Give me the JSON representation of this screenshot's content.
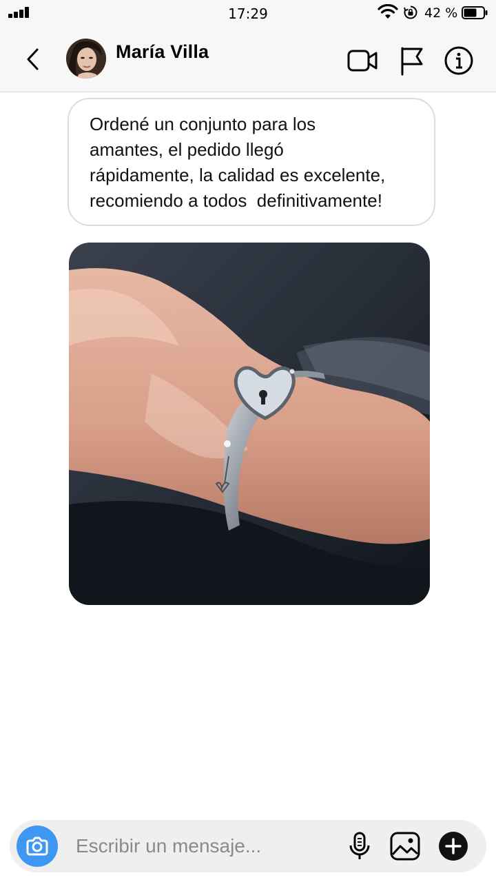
{
  "status_bar": {
    "time": "17:29",
    "battery_percent": "42 %",
    "battery_level": 0.42,
    "signal_bars": 4
  },
  "header": {
    "contact_name": "María Villa",
    "icons": [
      "back-chevron-icon",
      "avatar",
      "video-camera-icon",
      "flag-icon",
      "info-icon"
    ]
  },
  "messages": [
    {
      "type": "text",
      "text": "Ordené un conjunto para los\namantes, el pedido llegó\nrápidamente, la calidad es excelente,\nrecomiendo a todos  definitivamente!"
    },
    {
      "type": "photo",
      "description_icon": "bracelet-photo"
    }
  ],
  "composer": {
    "placeholder": "Escribir un mensaje...",
    "icons": [
      "camera-icon",
      "microphone-icon",
      "gallery-icon",
      "plus-icon"
    ]
  },
  "colors": {
    "camera_button": "#3e97f0",
    "bar_background": "#f7f7f7",
    "composer_background": "#efefef"
  }
}
